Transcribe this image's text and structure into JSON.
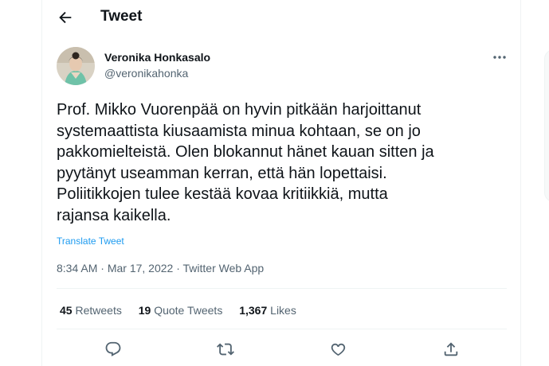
{
  "header": {
    "title": "Tweet",
    "back_icon": "arrow-left-icon"
  },
  "author": {
    "display_name": "Veronika Honkasalo",
    "handle": "@veronikahonka",
    "more_icon": "more-horizontal-icon"
  },
  "tweet": {
    "lines": [
      "Prof. Mikko Vuorenpää on hyvin pitkään harjoittanut",
      "systemaattista kiusaamista minua kohtaan, se on jo",
      "pakkomielteistä. Olen blokannut hänet kauan sitten ja",
      "pyytänyt useamman kerran, että hän lopettaisi.",
      "Poliitikkojen tulee kestää kovaa kritiikkiä, mutta",
      "rajansa kaikella."
    ],
    "translate_label": "Translate Tweet",
    "time": "8:34 AM",
    "separator": " · ",
    "date": "Mar 17, 2022",
    "source": "Twitter Web App"
  },
  "stats": {
    "retweets_count": "45",
    "retweets_label": "Retweets",
    "quotes_count": "19",
    "quotes_label": "Quote Tweets",
    "likes_count": "1,367",
    "likes_label": "Likes"
  },
  "actions": [
    "reply-icon",
    "retweet-icon",
    "like-icon",
    "share-icon"
  ],
  "colors": {
    "accent": "#1d9bf0",
    "muted": "#536471",
    "text": "#0f1419",
    "border": "#eff3f4"
  }
}
